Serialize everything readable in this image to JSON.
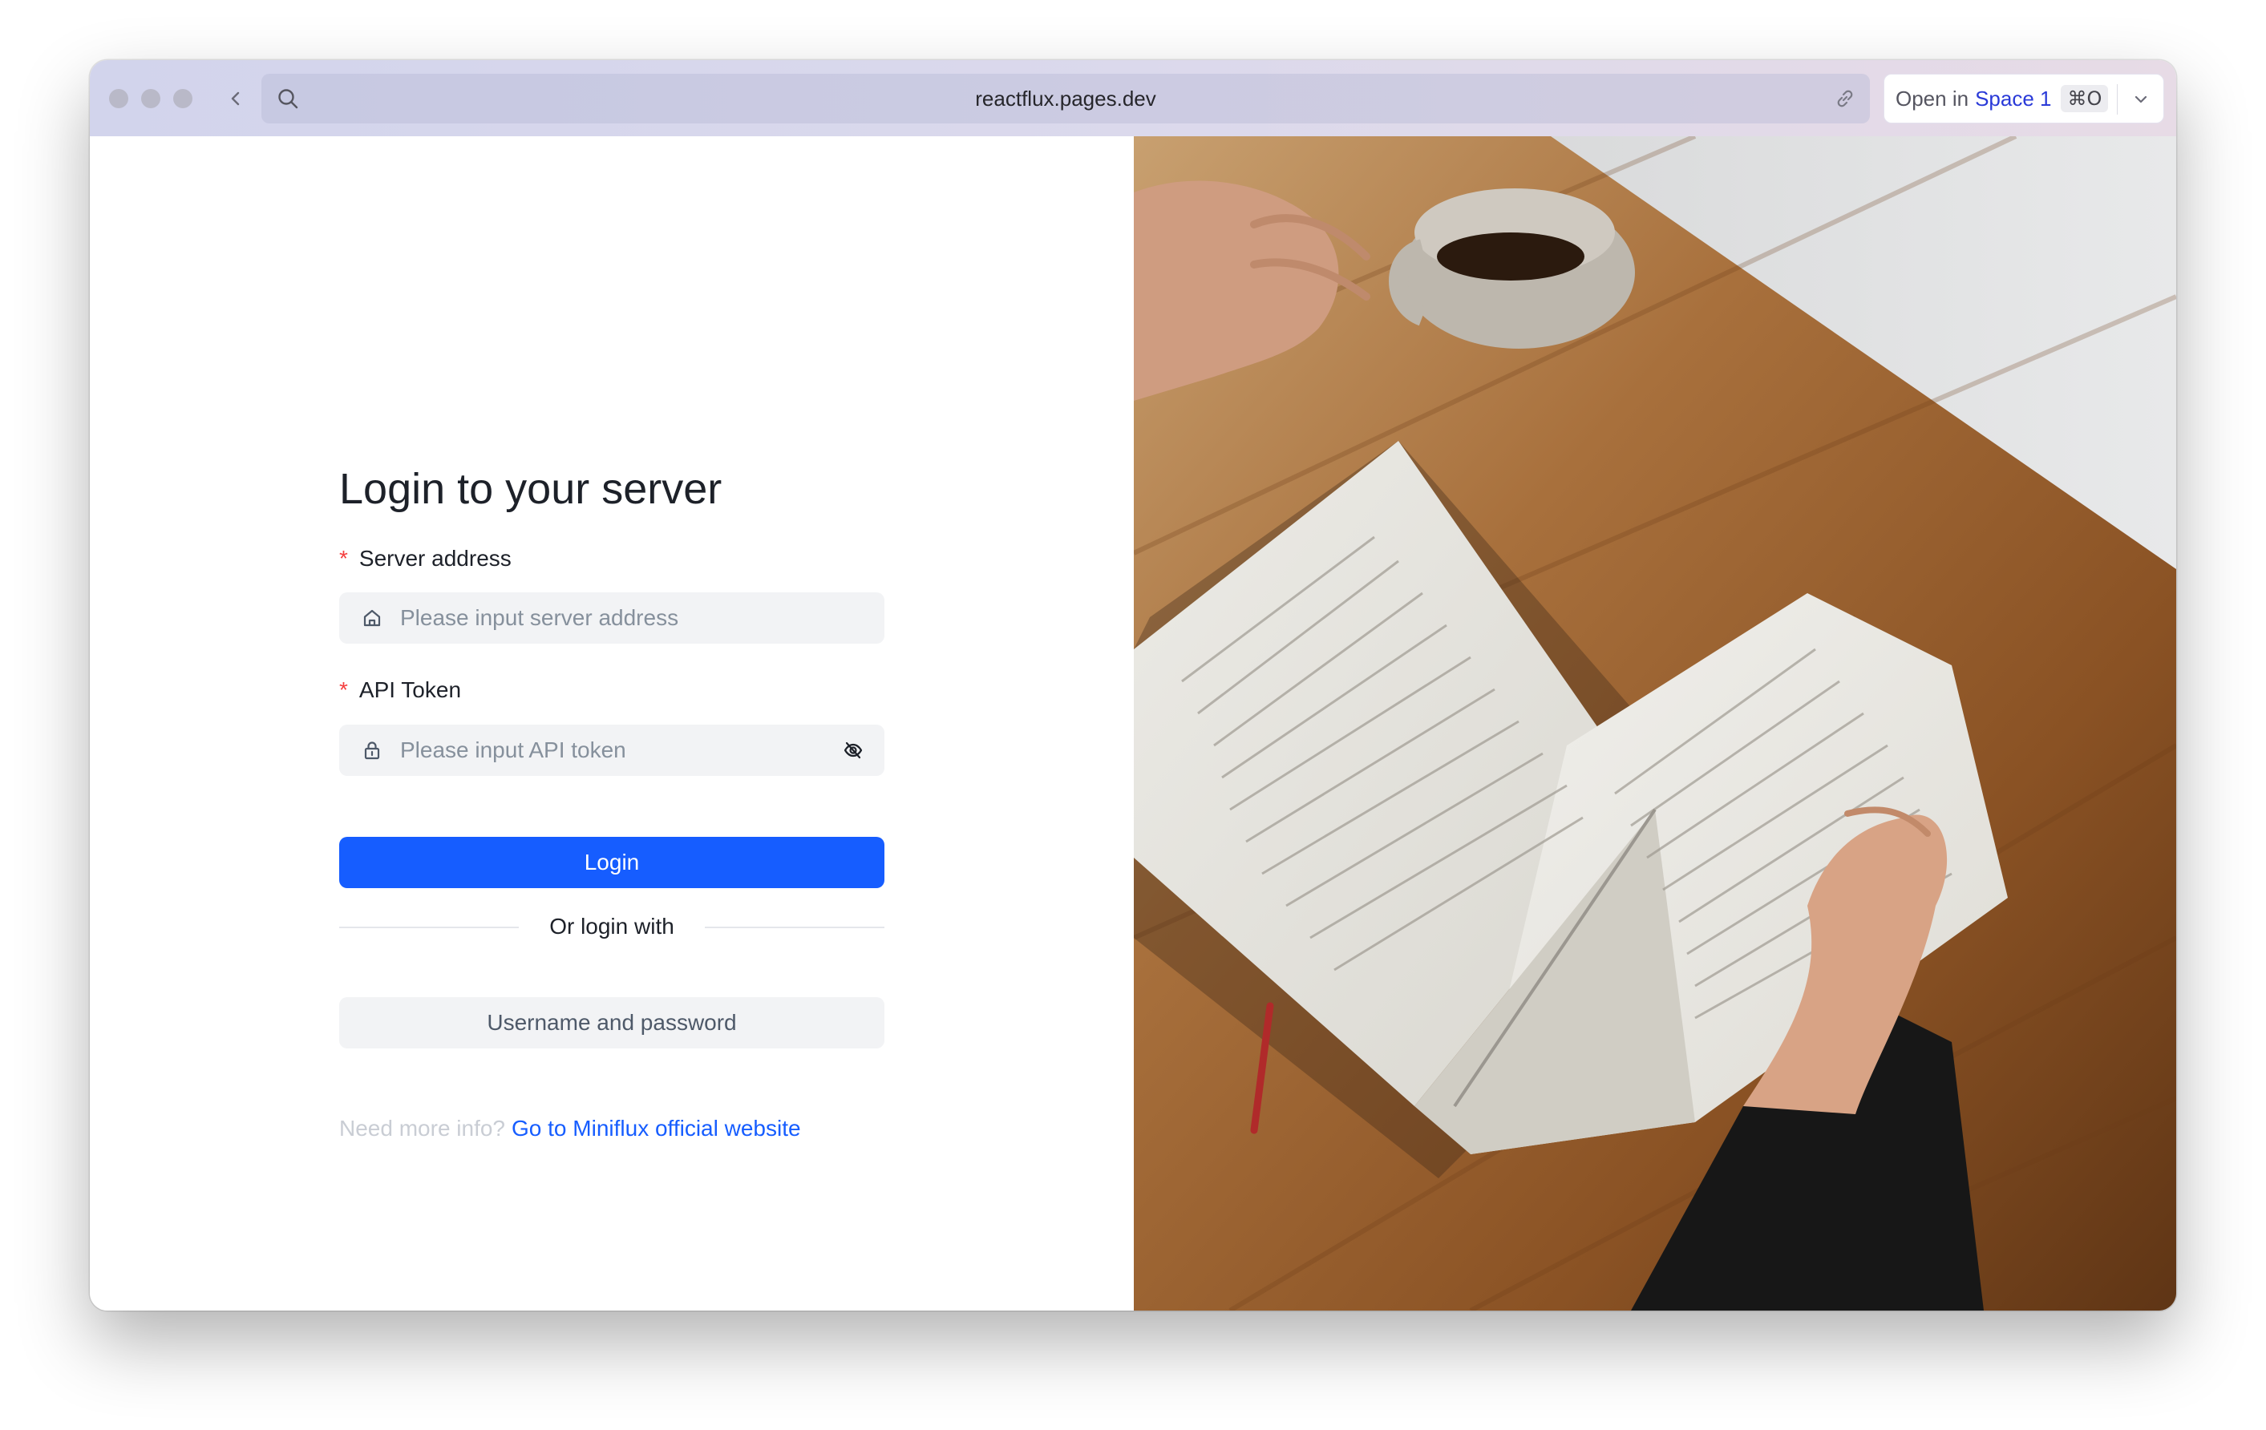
{
  "browser": {
    "url": "reactflux.pages.dev",
    "open_button": {
      "prefix": "Open in",
      "space": "Space 1",
      "shortcut": "⌘O"
    }
  },
  "login": {
    "title": "Login to your server",
    "server_address": {
      "label": "Server address",
      "required_mark": "*",
      "placeholder": "Please input server address"
    },
    "api_token": {
      "label": "API Token",
      "required_mark": "*",
      "placeholder": "Please input API token"
    },
    "login_button": "Login",
    "divider_text": "Or login with",
    "alt_login_button": "Username and password",
    "info_text": "Need more info?",
    "info_link": "Go to Miniflux official website"
  },
  "colors": {
    "primary": "#165dff",
    "required": "#f53f3f",
    "input_bg": "#f2f3f5"
  },
  "icons": {
    "server_input": "home-icon",
    "token_input": "lock-icon",
    "token_visibility": "eye-off-icon"
  }
}
